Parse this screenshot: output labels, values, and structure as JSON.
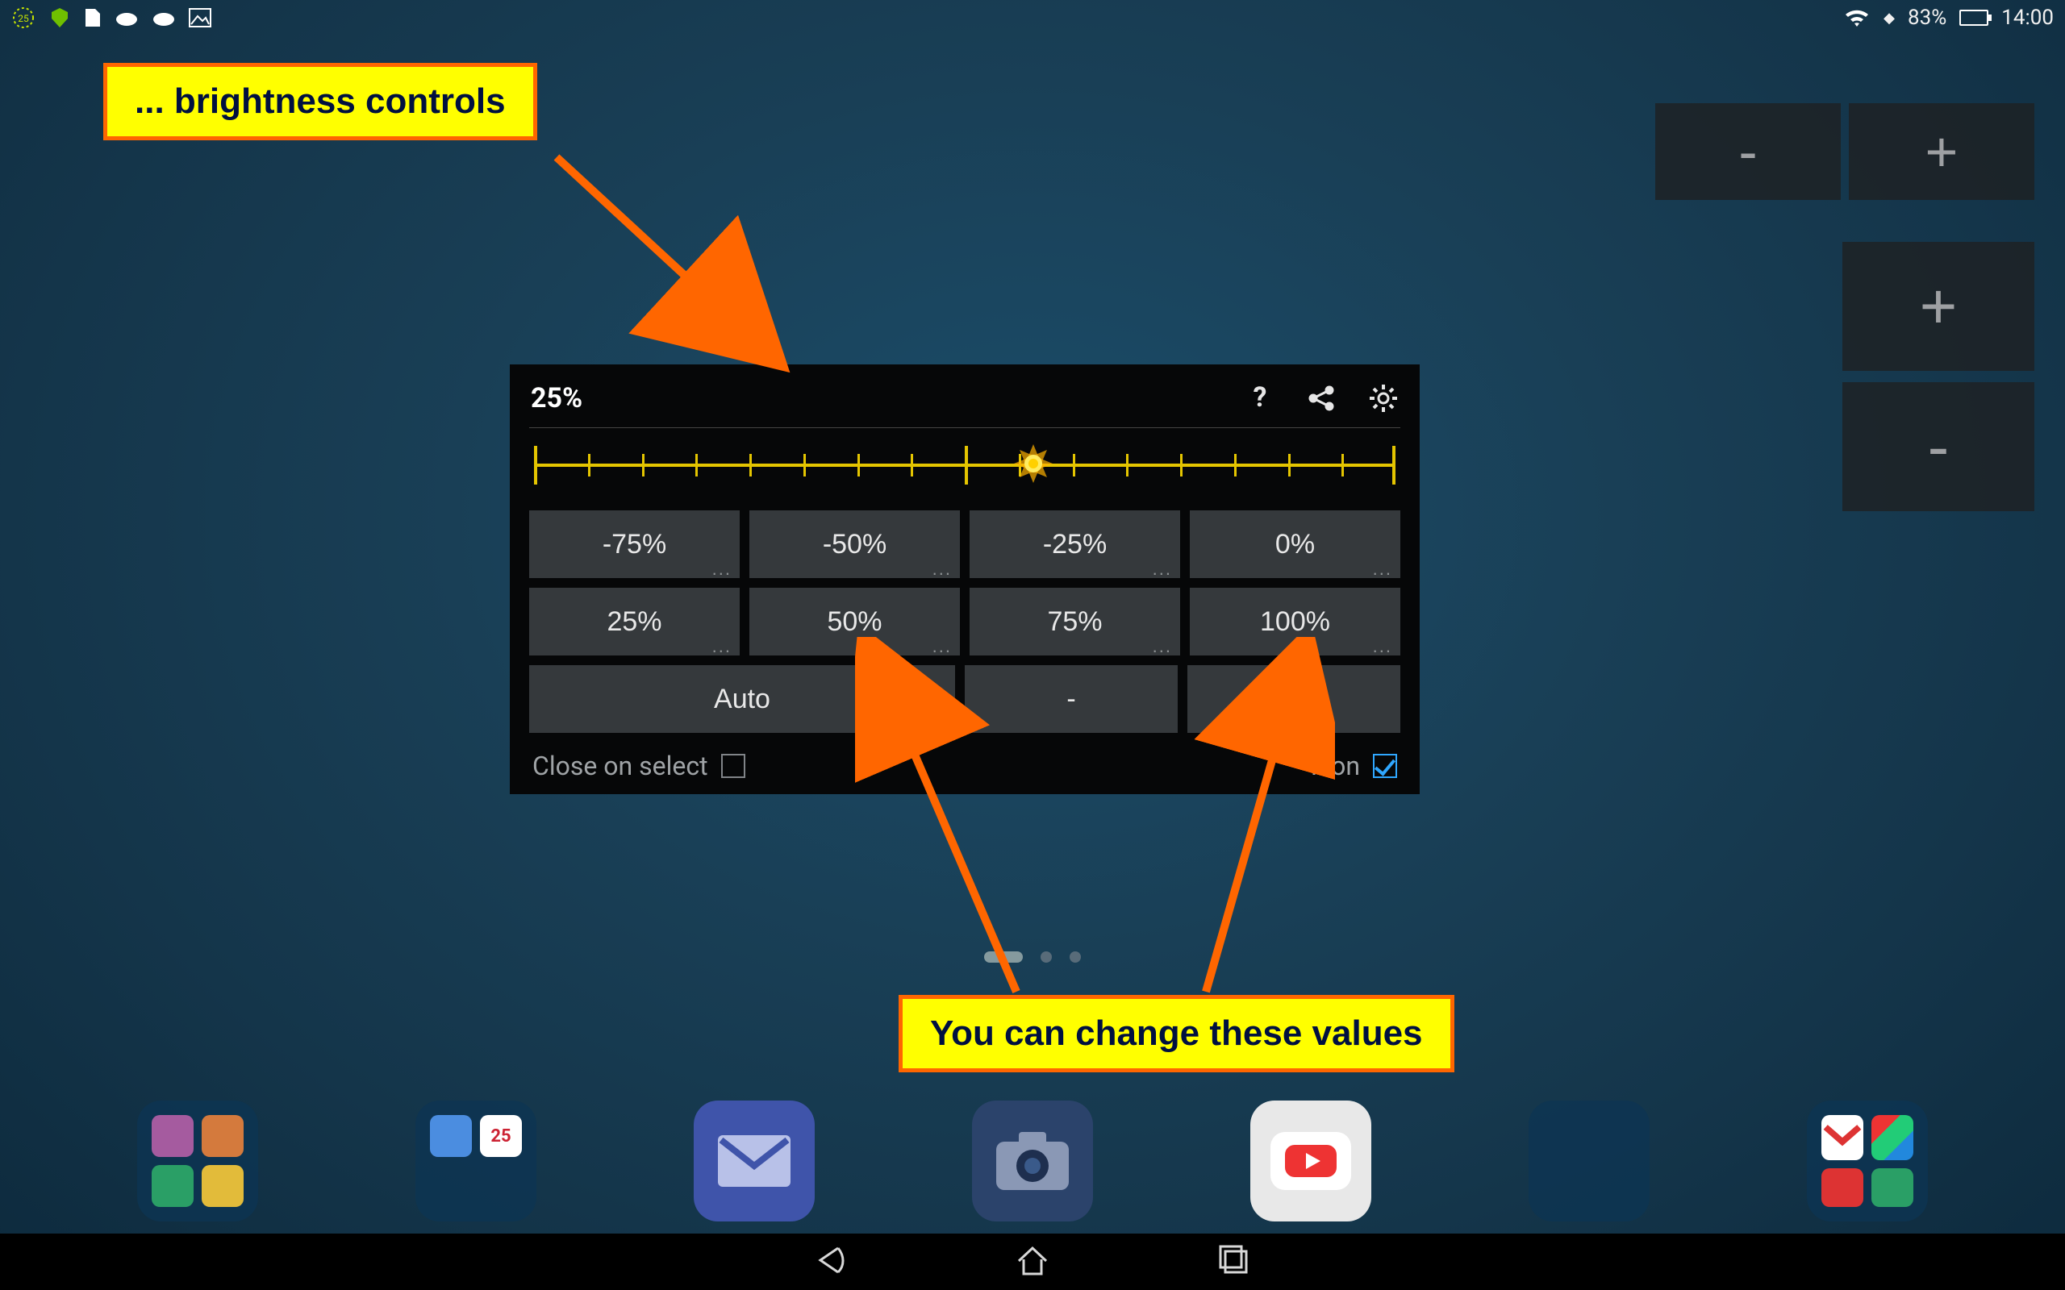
{
  "statusbar": {
    "battery_percent": "83%",
    "time": "14:00"
  },
  "callouts": {
    "top": "... brightness controls",
    "bottom": "You can change these values"
  },
  "corner": {
    "minus": "-",
    "plus": "+"
  },
  "dialog": {
    "current": "25%",
    "presets": [
      "-75%",
      "-50%",
      "-25%",
      "0%",
      "25%",
      "50%",
      "75%",
      "100%"
    ],
    "auto_label": "Auto",
    "dec_label": "-",
    "inc_label": "+",
    "close_label": "Close on select",
    "icon_label": "Icon",
    "slider_position_percent": 58
  }
}
